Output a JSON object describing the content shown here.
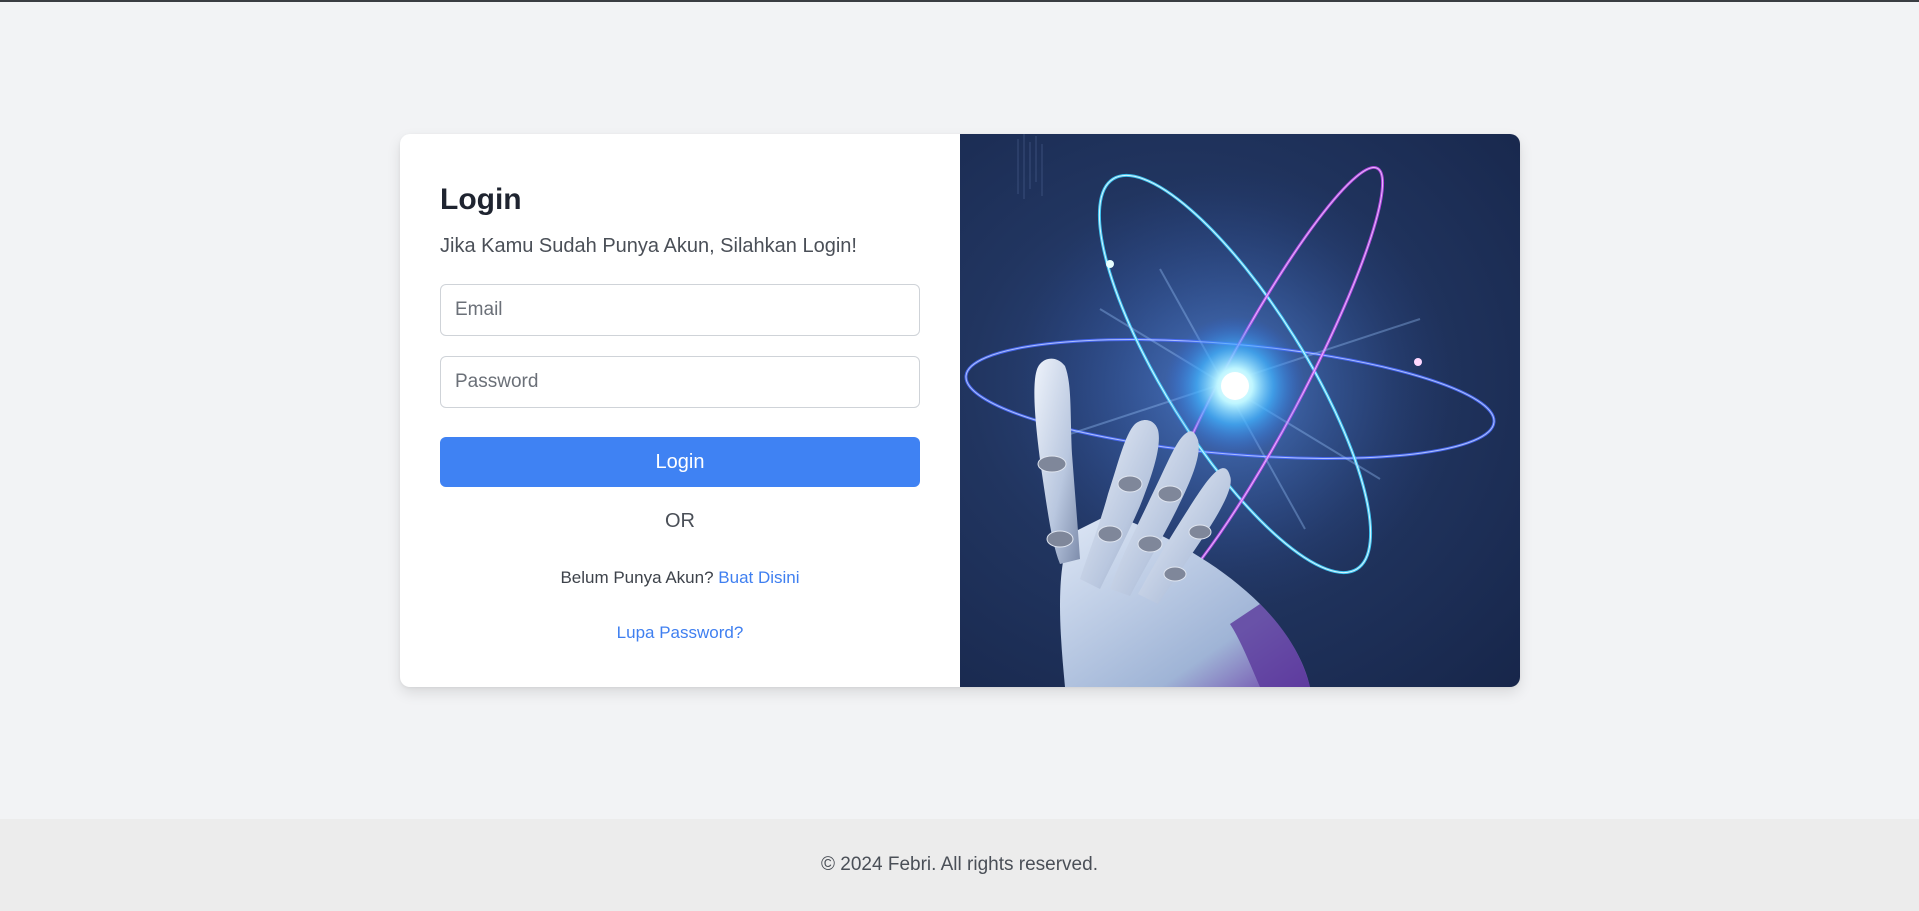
{
  "login": {
    "title": "Login",
    "subtitle": "Jika Kamu Sudah Punya Akun, Silahkan Login!",
    "email_placeholder": "Email",
    "password_placeholder": "Password",
    "submit_label": "Login",
    "or_text": "OR",
    "register_prompt": "Belum Punya Akun?",
    "register_link": "Buat Disini",
    "forgot_link": "Lupa Password?"
  },
  "hero_image": {
    "icon": "robot-hand-atom-illustration"
  },
  "footer": {
    "copyright": "© 2024 Febri. All rights reserved."
  },
  "colors": {
    "accent": "#3f82f3",
    "link": "#3f7ff0",
    "background": "#f2f3f5"
  }
}
